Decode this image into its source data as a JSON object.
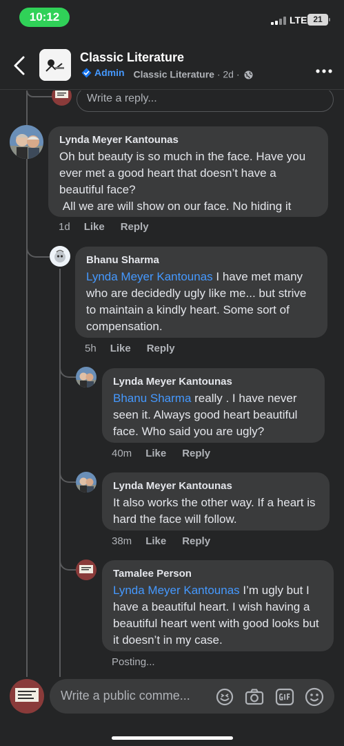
{
  "status": {
    "time": "10:12",
    "network": "LTE",
    "battery": "21"
  },
  "header": {
    "group_name": "Classic Literature",
    "role": "Admin",
    "group_sub": "Classic Literature",
    "age": "· 2d ·"
  },
  "reply_box": {
    "placeholder": "Write a reply..."
  },
  "comments": [
    {
      "author": "Lynda Meyer Kantounas",
      "mention": "",
      "text": "Oh but beauty is so much in the face. Have you ever met a good heart that doesn’t have a beautiful face?\n All we are will show on our face. No hiding it",
      "time": "1d",
      "like": "Like",
      "reply": "Reply"
    },
    {
      "author": "Bhanu Sharma",
      "mention": "Lynda Meyer Kantounas",
      "text": " I have met many who are decidedly ugly like me... but strive to maintain a kindly heart. Some sort of compensation.",
      "time": "5h",
      "like": "Like",
      "reply": "Reply"
    },
    {
      "author": "Lynda Meyer Kantounas",
      "mention": "Bhanu Sharma",
      "text": " really . I have never seen it. Always good heart beautiful face. Who said you are ugly?",
      "time": "40m",
      "like": "Like",
      "reply": "Reply"
    },
    {
      "author": "Lynda Meyer Kantounas",
      "mention": "",
      "text": "It also works the other way. If a heart is hard the face will follow.",
      "time": "38m",
      "like": "Like",
      "reply": "Reply"
    },
    {
      "author": "Tamalee Person",
      "mention": "Lynda Meyer Kantounas",
      "text": " I’m ugly but I have a beautiful heart. I wish having a beautiful heart went with good looks but it doesn’t in my case.",
      "status": "Posting..."
    }
  ],
  "composer": {
    "placeholder": "Write a public comme..."
  },
  "icons": [
    "back-chevron-icon",
    "admin-shield-icon",
    "globe-icon",
    "more-icon",
    "avatar-sticker-icon",
    "camera-icon",
    "gif-icon",
    "smiley-icon"
  ],
  "colors": {
    "background": "#242526",
    "bubble": "#3a3b3c",
    "mention": "#4599ff",
    "time_pill": "#30d158",
    "secondary_text": "#b0b3b8"
  }
}
